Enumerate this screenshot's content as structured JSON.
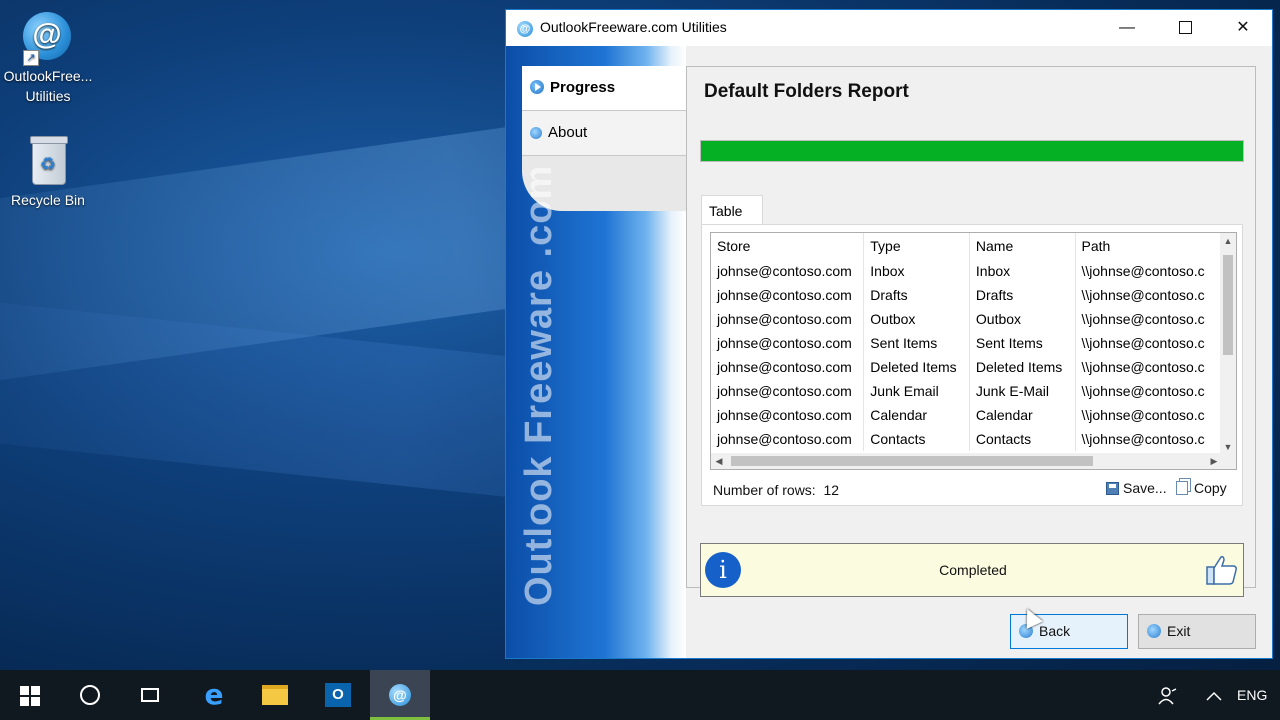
{
  "desktop": {
    "icons": [
      {
        "label": "OutlookFree...\nUtilities",
        "line1": "OutlookFree...",
        "line2": "Utilities",
        "glyph": "@"
      },
      {
        "label": "Recycle Bin",
        "line1": "Recycle Bin"
      }
    ]
  },
  "window": {
    "title": "OutlookFreeware.com Utilities",
    "icon_glyph": "@",
    "controls": {
      "minimize": "—",
      "close": "✕"
    }
  },
  "sidebar": {
    "tabs": [
      {
        "label": "Progress",
        "icon": "play-icon",
        "active": true
      },
      {
        "label": "About",
        "icon": "info-icon",
        "active": false
      }
    ],
    "brand": "Outlook Freeware .com"
  },
  "main": {
    "heading": "Default Folders Report",
    "progress_percent": 100,
    "progress_color": "#06b025",
    "tab_label": "Table",
    "table": {
      "columns": [
        "Store",
        "Type",
        "Name",
        "Path"
      ],
      "rows": [
        [
          "johnse@contoso.com",
          "Inbox",
          "Inbox",
          "\\\\johnse@contoso.c"
        ],
        [
          "johnse@contoso.com",
          "Drafts",
          "Drafts",
          "\\\\johnse@contoso.c"
        ],
        [
          "johnse@contoso.com",
          "Outbox",
          "Outbox",
          "\\\\johnse@contoso.c"
        ],
        [
          "johnse@contoso.com",
          "Sent Items",
          "Sent Items",
          "\\\\johnse@contoso.c"
        ],
        [
          "johnse@contoso.com",
          "Deleted Items",
          "Deleted Items",
          "\\\\johnse@contoso.c"
        ],
        [
          "johnse@contoso.com",
          "Junk Email",
          "Junk E-Mail",
          "\\\\johnse@contoso.c"
        ],
        [
          "johnse@contoso.com",
          "Calendar",
          "Calendar",
          "\\\\johnse@contoso.c"
        ],
        [
          "johnse@contoso.com",
          "Contacts",
          "Contacts",
          "\\\\johnse@contoso.c"
        ]
      ]
    },
    "rows_label": "Number of rows:",
    "rows_count": "12",
    "save_label": "Save...",
    "copy_label": "Copy",
    "status": {
      "message": "Completed",
      "info_glyph": "i"
    }
  },
  "buttons": {
    "back": "Back",
    "exit": "Exit"
  },
  "taskbar": {
    "outlook_glyph": "O",
    "app_glyph": "@",
    "edge_glyph": "e",
    "language": "ENG"
  },
  "colors": {
    "accent": "#0078d7",
    "progress": "#06b025",
    "status_bg": "#fbfbe0"
  }
}
